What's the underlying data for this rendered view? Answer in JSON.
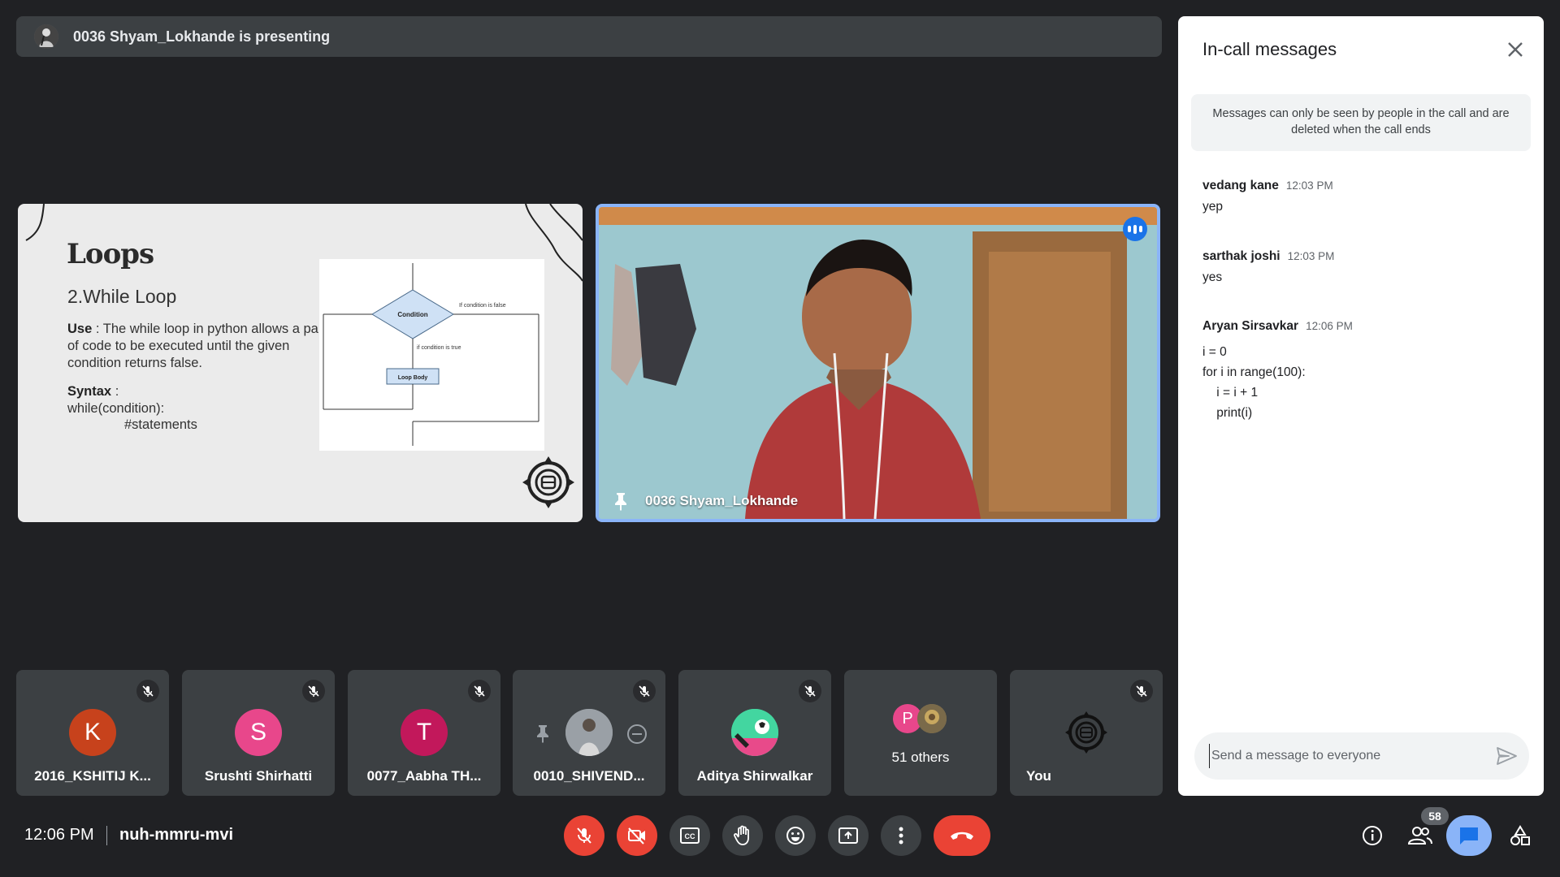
{
  "banner": {
    "text": "0036 Shyam_Lokhande is presenting"
  },
  "slide": {
    "title": "Loops",
    "subtitle": "2.While Loop",
    "use_label": "Use",
    "use_text": " : The while loop in python allows a part of code to be executed until the given condition returns false.",
    "syntax_label": "Syntax",
    "syntax_colon": " :",
    "syntax_line": "while(condition):",
    "statement": "#statements",
    "flow": {
      "condition": "Condition",
      "false_label": "If condition is false",
      "true_label": "if condition is true",
      "body": "Loop Body"
    }
  },
  "presenter": {
    "name": "0036 Shyam_Lokhande"
  },
  "participants": [
    {
      "name": "2016_KSHITIJ K...",
      "initial": "K",
      "color": "#c7421c"
    },
    {
      "name": "Srushti Shirhatti",
      "initial": "S",
      "color": "#e8478b"
    },
    {
      "name": "0077_Aabha TH...",
      "initial": "T",
      "color": "#c2185b"
    },
    {
      "name": "0010_SHIVEND..."
    },
    {
      "name": "Aditya Shirwalkar"
    },
    {
      "others": "51 others",
      "initial": "P",
      "color": "#e8478b"
    },
    {
      "name": "You"
    }
  ],
  "chat": {
    "title": "In-call messages",
    "notice": "Messages can only be seen by people in the call and are deleted when the call ends",
    "messages": [
      {
        "sender": "vedang kane",
        "time": "12:03 PM",
        "text": "yep"
      },
      {
        "sender": "sarthak joshi",
        "time": "12:03 PM",
        "text": "yes"
      },
      {
        "sender": "Aryan Sirsavkar",
        "time": "12:06 PM",
        "text": "i = 0\nfor i in range(100):\n    i = i + 1\n    print(i)"
      }
    ],
    "input_placeholder": "Send a message to everyone"
  },
  "bottom": {
    "time": "12:06 PM",
    "meeting_code": "nuh-mmru-mvi",
    "people_count": "58"
  },
  "colors": {
    "accent": "#8ab4f8",
    "danger": "#ea4335",
    "bar": "#3c4043"
  }
}
